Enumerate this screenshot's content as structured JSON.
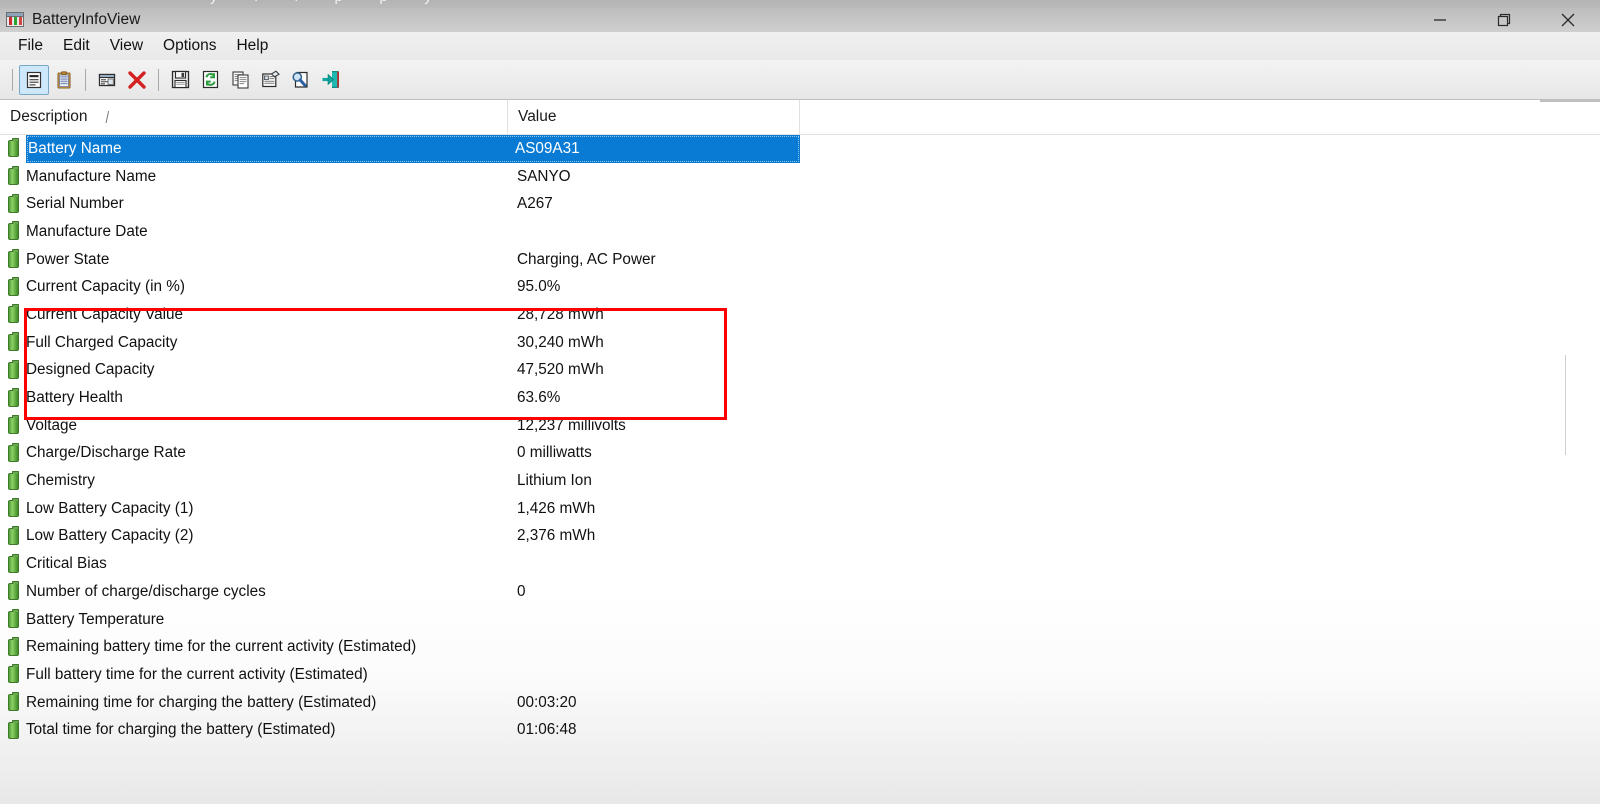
{
  "window": {
    "title": "BatteryInfoView",
    "app_icon": "battery-bars-icon",
    "controls": [
      {
        "name": "minimize",
        "glyph": "minimize-icon"
      },
      {
        "name": "restore",
        "glyph": "restore-icon"
      },
      {
        "name": "close",
        "glyph": "close-icon"
      }
    ]
  },
  "menu": {
    "items": [
      {
        "label": "File"
      },
      {
        "label": "Edit"
      },
      {
        "label": "View"
      },
      {
        "label": "Options"
      },
      {
        "label": "Help"
      }
    ]
  },
  "toolbar": {
    "buttons": [
      {
        "name": "properties-button",
        "icon": "document-properties-icon",
        "active": true
      },
      {
        "name": "clipboard-button",
        "icon": "clipboard-icon",
        "active": false
      },
      {
        "name": "select-all-button",
        "icon": "window-list-icon",
        "active": false
      },
      {
        "name": "delete-button",
        "icon": "red-x-icon",
        "active": false
      },
      {
        "name": "save-button",
        "icon": "floppy-disk-icon",
        "active": false
      },
      {
        "name": "refresh-button",
        "icon": "refresh-page-icon",
        "active": false
      },
      {
        "name": "copy-button",
        "icon": "copy-pages-icon",
        "active": false
      },
      {
        "name": "report-button",
        "icon": "html-report-icon",
        "active": false
      },
      {
        "name": "find-button",
        "icon": "magnifier-page-icon",
        "active": false
      },
      {
        "name": "exit-button",
        "icon": "exit-door-arrow-icon",
        "active": false
      }
    ]
  },
  "list": {
    "columns": [
      {
        "label": "Description",
        "sort_indicator": "/"
      },
      {
        "label": "Value",
        "sort_indicator": ""
      }
    ],
    "rows": [
      {
        "description": "Battery Name",
        "value": "AS09A31",
        "selected": true
      },
      {
        "description": "Manufacture Name",
        "value": "SANYO",
        "selected": false
      },
      {
        "description": "Serial Number",
        "value": "A267",
        "selected": false
      },
      {
        "description": "Manufacture Date",
        "value": "",
        "selected": false
      },
      {
        "description": "Power State",
        "value": "Charging, AC Power",
        "selected": false
      },
      {
        "description": "Current Capacity (in %)",
        "value": "95.0%",
        "selected": false
      },
      {
        "description": "Current Capacity Value",
        "value": "28,728 mWh",
        "selected": false
      },
      {
        "description": "Full Charged Capacity",
        "value": "30,240 mWh",
        "selected": false
      },
      {
        "description": "Designed Capacity",
        "value": "47,520 mWh",
        "selected": false
      },
      {
        "description": "Battery Health",
        "value": "63.6%",
        "selected": false
      },
      {
        "description": "Voltage",
        "value": "12,237 millivolts",
        "selected": false
      },
      {
        "description": "Charge/Discharge Rate",
        "value": "0 milliwatts",
        "selected": false
      },
      {
        "description": "Chemistry",
        "value": "Lithium Ion",
        "selected": false
      },
      {
        "description": "Low Battery Capacity (1)",
        "value": "1,426 mWh",
        "selected": false
      },
      {
        "description": "Low Battery Capacity (2)",
        "value": "2,376 mWh",
        "selected": false
      },
      {
        "description": "Critical Bias",
        "value": "",
        "selected": false
      },
      {
        "description": "Number of charge/discharge cycles",
        "value": "0",
        "selected": false
      },
      {
        "description": "Battery Temperature",
        "value": "",
        "selected": false
      },
      {
        "description": "Remaining battery time for the current activity (Estimated)",
        "value": "",
        "selected": false
      },
      {
        "description": "Full battery time for the current activity (Estimated)",
        "value": "",
        "selected": false
      },
      {
        "description": "Remaining time for charging the battery (Estimated)",
        "value": "00:03:20",
        "selected": false
      },
      {
        "description": "Total  time for charging the battery (Estimated)",
        "value": "01:06:48",
        "selected": false
      }
    ]
  },
  "annotation": {
    "highlight_color": "#ff0000",
    "highlighted_rows": [
      "Current Capacity Value",
      "Full Charged Capacity",
      "Designed Capacity",
      "Battery Health"
    ]
  },
  "colors": {
    "selection": "#0a7bd4",
    "battery_icon": "#6fb84b",
    "annotation": "#ff0000"
  }
}
